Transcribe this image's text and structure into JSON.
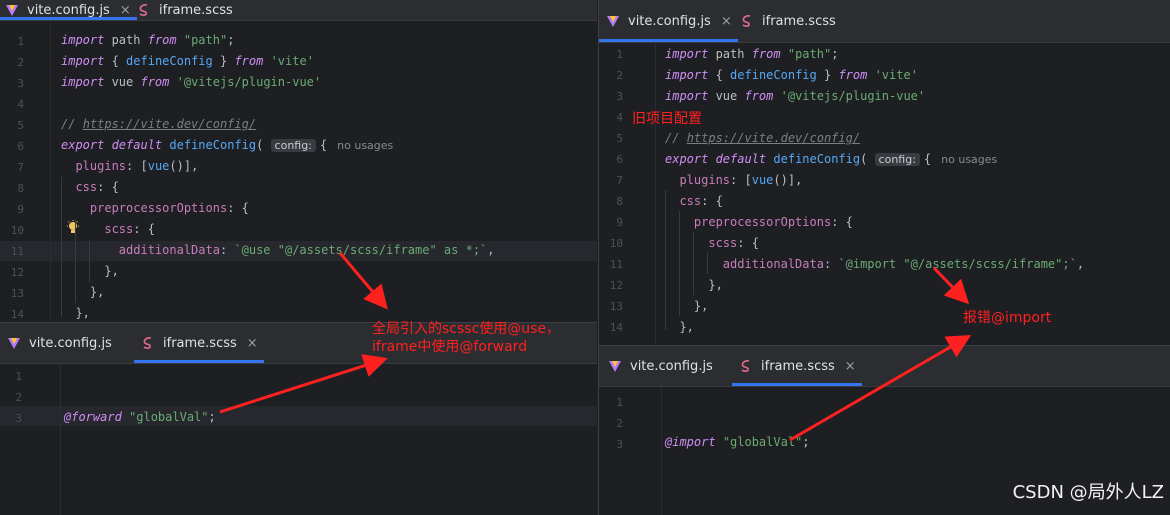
{
  "left": {
    "top_tabs": [
      {
        "label": "vite.config.js",
        "close": "×",
        "icon": "vite-icon"
      },
      {
        "label": "iframe.scss",
        "icon": "sass-icon"
      }
    ],
    "code_lines": [
      "1",
      "2",
      "3",
      "4",
      "5",
      "6",
      "7",
      "8",
      "9",
      "10",
      "11",
      "12",
      "13",
      "14"
    ],
    "code": {
      "hint_config": "config:",
      "no_usages": "no usages",
      "url": "https://vite.dev/config/",
      "additional_data": "`@use \"@/assets/scss/iframe\" as *;`"
    },
    "bottom_tabs": [
      {
        "label": "vite.config.js",
        "icon": "vite-icon"
      },
      {
        "label": "iframe.scss",
        "close": "×",
        "icon": "sass-icon"
      }
    ],
    "scss_lines": [
      "1",
      "2",
      "3"
    ],
    "scss_directive": "@forward",
    "scss_value": "\"globalVal\""
  },
  "right": {
    "top_tabs": [
      {
        "label": "vite.config.js",
        "close": "×",
        "icon": "vite-icon"
      },
      {
        "label": "iframe.scss",
        "icon": "sass-icon"
      }
    ],
    "code_lines": [
      "1",
      "2",
      "3",
      "4",
      "5",
      "6",
      "7",
      "8",
      "9",
      "10",
      "11",
      "12",
      "13",
      "14"
    ],
    "code": {
      "hint_config": "config:",
      "no_usages": "no usages",
      "url": "https://vite.dev/config/",
      "additional_data": "`@import \"@/assets/scss/iframe\";`"
    },
    "bottom_tabs": [
      {
        "label": "vite.config.js",
        "icon": "vite-icon"
      },
      {
        "label": "iframe.scss",
        "close": "×",
        "icon": "sass-icon"
      }
    ],
    "scss_lines": [
      "1",
      "2",
      "3"
    ],
    "scss_directive": "@import",
    "scss_value": "\"globalVal\""
  },
  "annotations": {
    "left_line1": "全局引入的scssc使用@use，",
    "left_line2": "iframe中使用@forward",
    "right_old": "旧项目配置",
    "right_error": "报错@import",
    "color": "#ff2020"
  },
  "watermark": "CSDN @局外人LZ",
  "colors": {
    "keyword": "#cf8ef4",
    "string": "#6aab73",
    "function": "#56a8f5",
    "property": "#c77dbb",
    "comment": "#7a7e85",
    "accent": "#3574f0"
  }
}
